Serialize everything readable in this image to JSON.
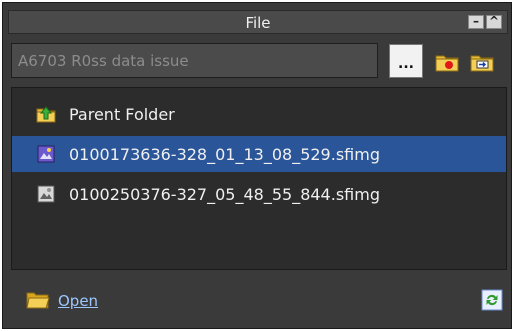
{
  "panel": {
    "title": "File",
    "minimize_label": "–",
    "maximize_label": "^"
  },
  "toolbar": {
    "path_value": "A6703 R0ss data issue",
    "browse_label": "..."
  },
  "list": {
    "items": [
      {
        "label": "Parent Folder",
        "icon": "parent-folder-icon",
        "selected": false
      },
      {
        "label": "0100173636-328_01_13_08_529.sfimg",
        "icon": "image-file-icon",
        "selected": true
      },
      {
        "label": "0100250376-327_05_48_55_844.sfimg",
        "icon": "image-file-icon",
        "selected": false
      }
    ]
  },
  "footer": {
    "open_label": "Open"
  },
  "colors": {
    "panel_bg": "#3a3a3a",
    "list_bg": "#2c2c2c",
    "selection": "#2a5599",
    "link": "#9cc7ff"
  }
}
